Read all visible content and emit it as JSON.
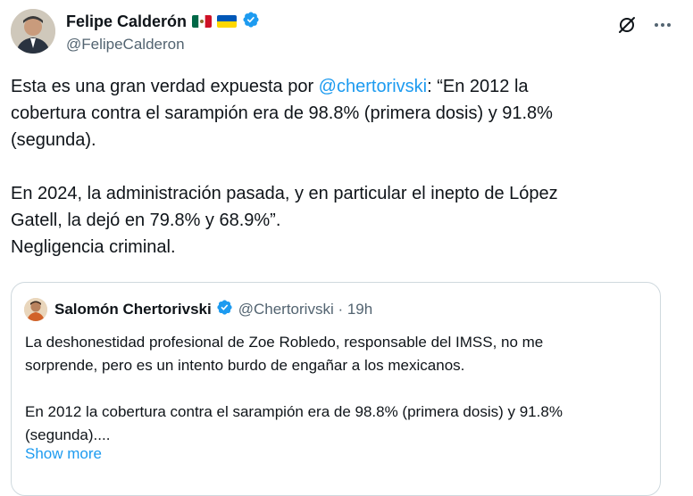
{
  "author": {
    "display_name": "Felipe Calderón",
    "handle": "@FelipeCalderon"
  },
  "tweet": {
    "text_before_mention": "Esta es una gran verdad expuesta por ",
    "mention": "@chertorivski",
    "text_after_mention": ": “En 2012 la\ncobertura contra el sarampión era de 98.8% (primera dosis) y 91.8%\n(segunda).\n\nEn 2024, la administración pasada, y en particular el inepto de López\nGatell, la dejó en 79.8% y 68.9%”.\nNegligencia criminal."
  },
  "quote": {
    "display_name": "Salomón Chertorivski",
    "handle": "@Chertorivski",
    "separator": " · ",
    "time": "19h",
    "text": "La deshonestidad profesional de Zoe Robledo, responsable del IMSS, no me\nsorprende, pero es un intento burdo de engañar a los mexicanos.\n\nEn 2012 la cobertura contra el sarampión era de 98.8% (primera dosis) y 91.8%\n(segunda)....",
    "show_more_label": "Show more"
  },
  "icons": {
    "verified": "verified-badge-icon",
    "grok": "grok-icon",
    "more": "more-options-icon",
    "flags": [
      "mexico-flag",
      "ukraine-flag"
    ]
  },
  "colors": {
    "accent": "#1d9bf0",
    "text": "#0f1419",
    "secondary_text": "#536471",
    "border": "#cfd9de"
  }
}
